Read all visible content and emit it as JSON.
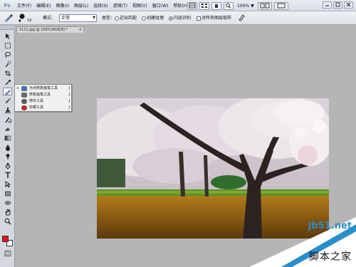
{
  "app": {
    "logo": "Ps"
  },
  "menubar": {
    "items": [
      "文件(F)",
      "编辑(E)",
      "图像(I)",
      "图层(L)",
      "选择(S)",
      "滤镜(T)",
      "视图(V)",
      "窗口(W)",
      "帮助(H)"
    ],
    "zoom": "100%",
    "zoom_arrow": "▼"
  },
  "options": {
    "brush_size": "19",
    "mode_label": "模式:",
    "mode_value": "正常",
    "type_label": "类型:",
    "type_options": [
      "近似匹配",
      "创建纹理",
      "内容识别"
    ],
    "selected_type": 2,
    "sample_all_layers": "对所有图层取样"
  },
  "document": {
    "tab_title": "1111.jpg @ 100%(RGB/8) *",
    "close_symbol": "×"
  },
  "flyout": {
    "items": [
      {
        "label": "污点修复画笔工具",
        "key": "J",
        "icon_color": "#4f6fa8",
        "selected": true
      },
      {
        "label": "修复画笔工具",
        "key": "J",
        "icon_color": "#6b6b6b",
        "selected": false
      },
      {
        "label": "修补工具",
        "key": "J",
        "icon_color": "#5a5a5a",
        "selected": false
      },
      {
        "label": "红眼工具",
        "key": "J",
        "icon_color": "#b03030",
        "selected": false
      }
    ],
    "check_symbol": "•"
  },
  "colors": {
    "foreground": "#e2151b",
    "background": "#ffffff",
    "workspace": "#b5b5b5"
  },
  "watermark": {
    "url": "jb51.net",
    "text": "脚本之家"
  }
}
